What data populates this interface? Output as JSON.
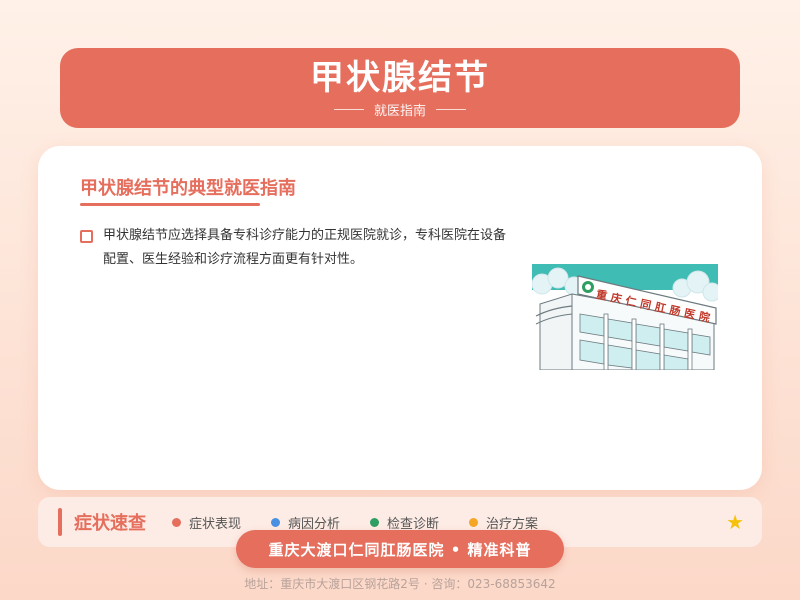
{
  "header": {
    "title": "甲状腺结节",
    "subtitle": "就医指南"
  },
  "card": {
    "title": "甲状腺结节的典型就医指南",
    "body": "甲状腺结节应选择具备专科诊疗能力的正规医院就诊，专科医院在设备配置、医生经验和诊疗流程方面更有针对性。",
    "hospital_sign": "重庆仁同肛肠医院"
  },
  "symptom_bar": {
    "title": "症状速查",
    "items": [
      {
        "label": "症状表现",
        "color": "#e56e5d"
      },
      {
        "label": "病因分析",
        "color": "#4a90e2"
      },
      {
        "label": "检查诊断",
        "color": "#2e9e61"
      },
      {
        "label": "治疗方案",
        "color": "#f5a623"
      }
    ],
    "star": "★"
  },
  "brand": "重庆大渡口仁同肛肠医院 • 精准科普",
  "footer": "地址：重庆市大渡口区钢花路2号 · 咨询：023-68853642"
}
